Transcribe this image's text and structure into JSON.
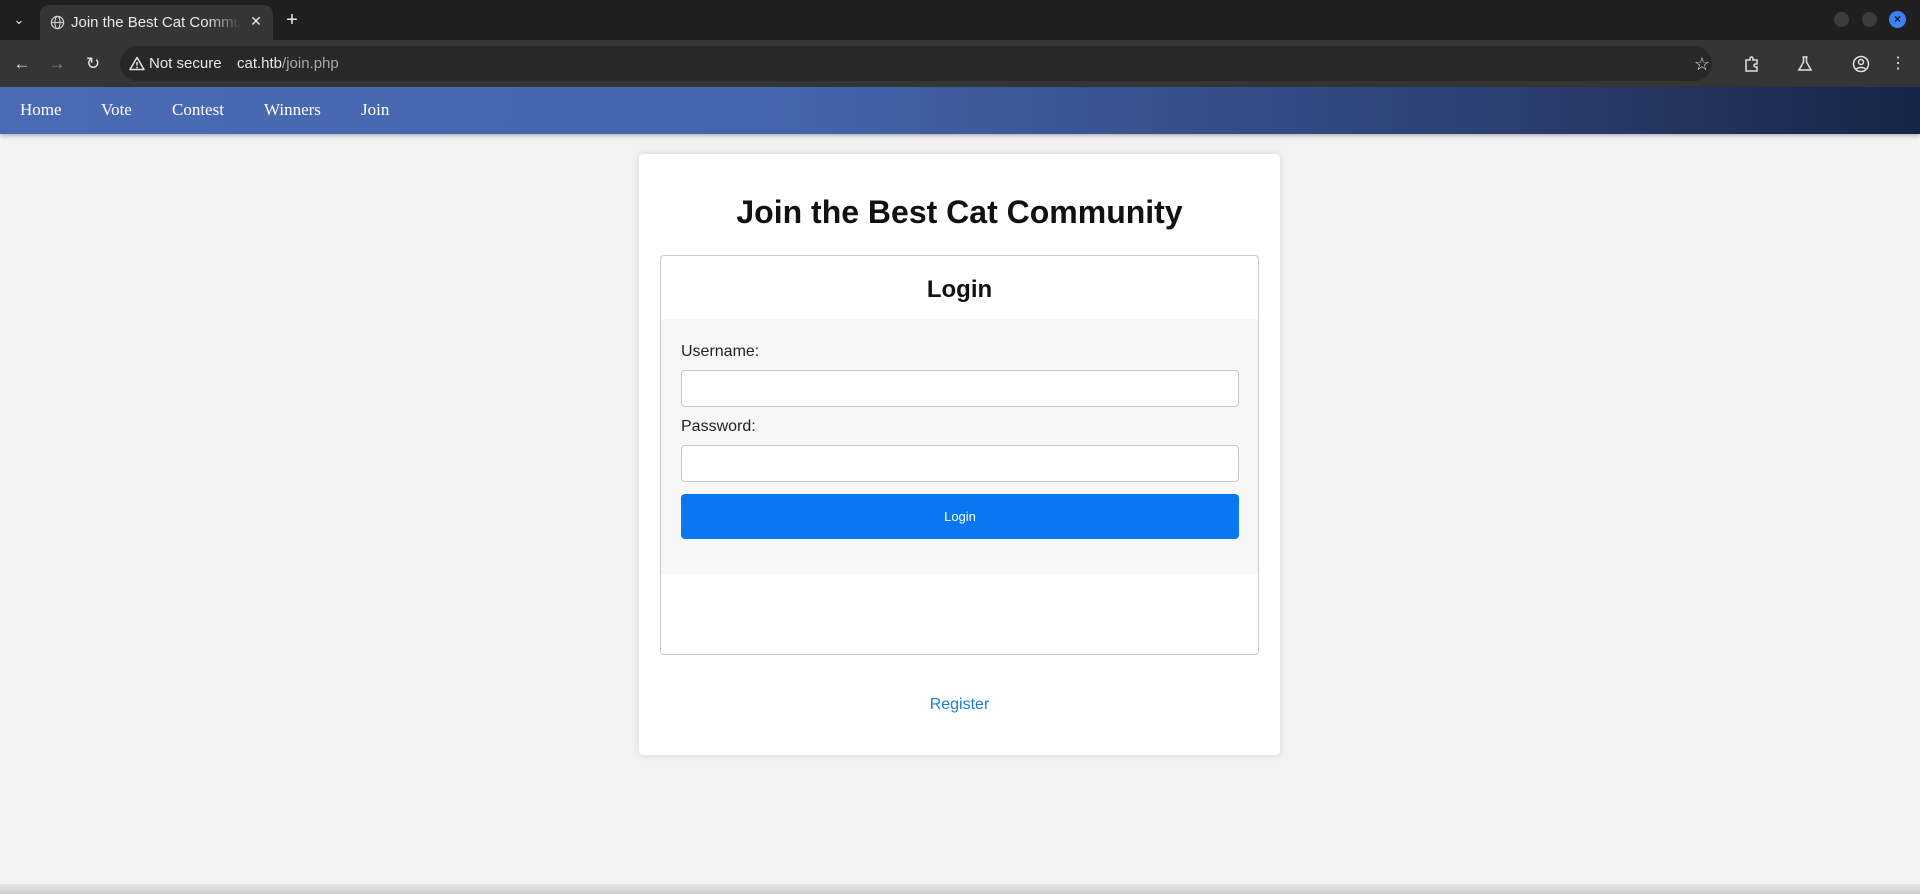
{
  "browser": {
    "tab_title": "Join the Best Cat Community",
    "tab_close": "✕",
    "new_tab": "+",
    "security_label": "Not secure",
    "url_host": "cat.htb",
    "url_path": "/join.php"
  },
  "nav": {
    "items": [
      {
        "label": "Home"
      },
      {
        "label": "Vote"
      },
      {
        "label": "Contest"
      },
      {
        "label": "Winners"
      },
      {
        "label": "Join"
      }
    ]
  },
  "page": {
    "title": "Join the Best Cat Community",
    "login": {
      "heading": "Login",
      "username_label": "Username:",
      "username_value": "",
      "password_label": "Password:",
      "password_value": "",
      "submit_label": "Login"
    },
    "register_link": "Register"
  },
  "colors": {
    "nav_gradient_start": "#4a6ab6",
    "nav_gradient_end": "#172446",
    "primary_button": "#0a76f0",
    "link": "#1a7fd8",
    "window_close": "#3b82f6"
  },
  "icons": {
    "tab_favicon": "globe-icon",
    "security": "warning-triangle-icon",
    "bookmark": "star-icon",
    "extensions": "puzzle-icon",
    "labs": "flask-icon",
    "profile": "account-circle-icon",
    "menu": "kebab-menu-icon"
  }
}
